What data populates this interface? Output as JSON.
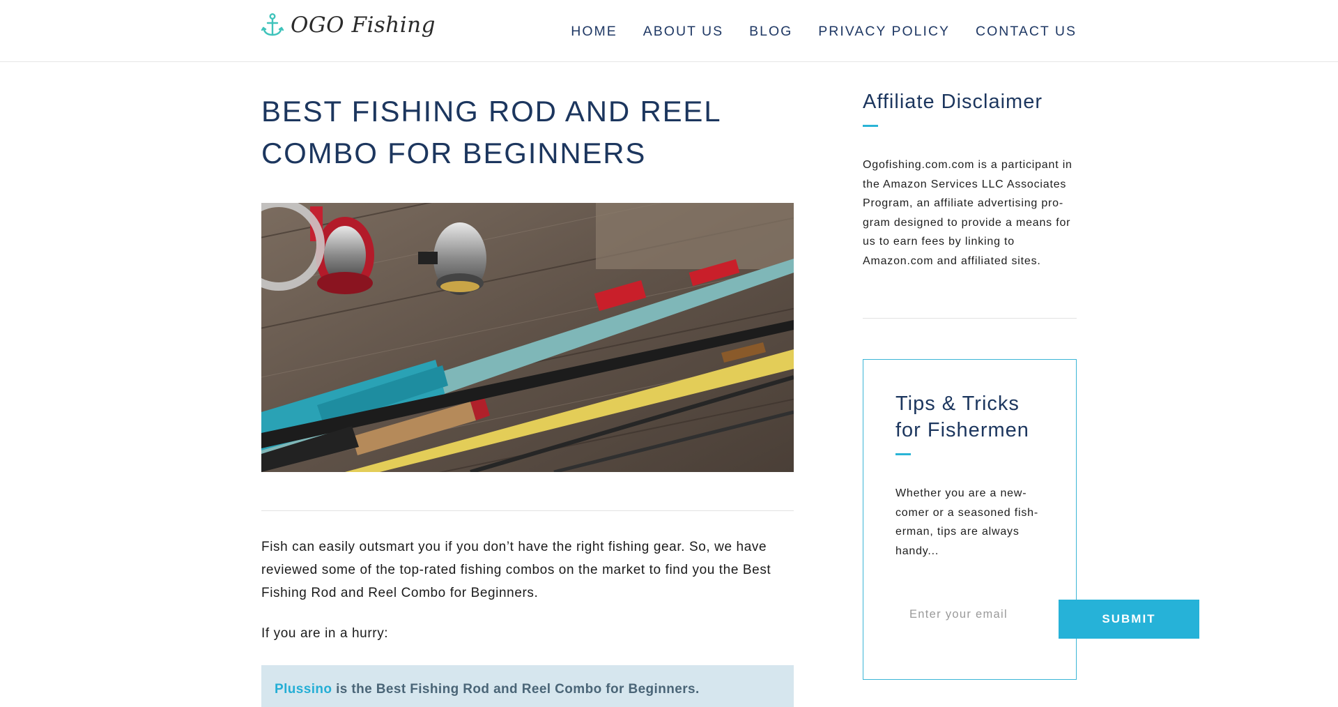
{
  "site": {
    "logo_text": "OGO Fishing"
  },
  "nav": {
    "items": [
      {
        "label": "HOME"
      },
      {
        "label": "ABOUT US"
      },
      {
        "label": "BLOG"
      },
      {
        "label": "PRIVACY POLICY"
      },
      {
        "label": "CONTACT US"
      }
    ]
  },
  "article": {
    "title_line1": "BEST FISHING ROD AND REEL",
    "title_line2": "COMBO FOR BEGINNERS",
    "para1": "Fish can easily outsmart you if you don’t have the right fishing gear. So, we have reviewed some of the top-rated fishing combos on the market to find you the Best Fishing Rod and Reel Combo for Beginners.",
    "para2": "If you are in a hurry:",
    "callout_link": "Plussino",
    "callout_rest": " is the Best Fishing Rod and Reel Combo for Beginners."
  },
  "sidebar": {
    "disclaimer_title": "Affiliate Disclaimer",
    "disclaimer_text": "Ogofishing.com.com is a participant in the Amazon Services LLC Associates Program, an affiliate advertising pro-gram designed to provide a means for us to earn fees by linking to Amazon.com and affiliated sites.",
    "tips_title_line1": "Tips & Tricks",
    "tips_title_line2": "for Fishermen",
    "tips_text": "Whether you are a new-comer or a seasoned fish-erman, tips are always handy...",
    "email_placeholder": "Enter your email",
    "submit_label": "SUBMIT"
  },
  "colors": {
    "brand_navy": "#1c365e",
    "accent": "#26b2d8",
    "callout_bg": "#d6e6ee"
  },
  "icons": {
    "logo": "anchor-icon"
  }
}
